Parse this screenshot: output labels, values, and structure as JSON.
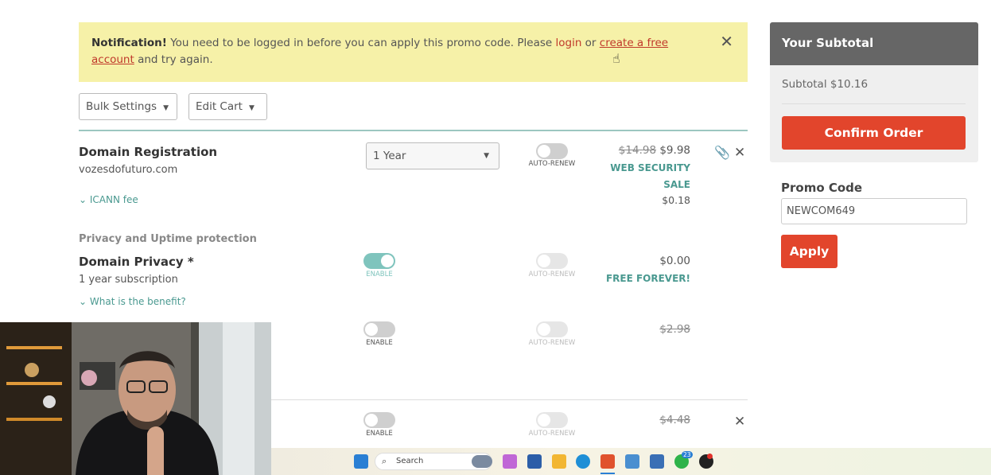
{
  "notification": {
    "bold": "Notification!",
    "text1": " You need to be logged in before you can apply this promo code. Please ",
    "login_link": "login",
    "text2": " or ",
    "create_link": "create a free account",
    "text3": " and try again."
  },
  "toolbar": {
    "bulk_settings": "Bulk Settings",
    "edit_cart": "Edit Cart"
  },
  "items": {
    "domain": {
      "title": "Domain Registration",
      "domain_name": "vozesdofuturo.com",
      "fee_toggle": "ICANN fee",
      "term": "1 Year",
      "toggle_label": "AUTO-RENEW",
      "old_price": "$14.98",
      "price": "$9.98",
      "badge_line1": "WEB SECURITY",
      "badge_line2": "SALE",
      "icann_price": "$0.18"
    },
    "section_title": "Privacy and Uptime protection",
    "privacy": {
      "title": "Domain Privacy *",
      "subtitle": "1 year subscription",
      "benefit_toggle": "What is the benefit?",
      "enable_label": "ENABLE",
      "auto_label": "AUTO-RENEW",
      "price": "$0.00",
      "badge": "FREE FOREVER!"
    },
    "item3": {
      "enable_label": "ENABLE",
      "auto_label": "AUTO-RENEW",
      "old_price": "$2.98"
    },
    "item4": {
      "enable_label": "ENABLE",
      "auto_label": "AUTO-RENEW",
      "old_price": "$4.48"
    }
  },
  "sidebar": {
    "header": "Your Subtotal",
    "subtotal": "Subtotal $10.16",
    "confirm": "Confirm Order",
    "promo_label": "Promo Code",
    "promo_value": "NEWCOM649",
    "apply": "Apply"
  },
  "taskbar": {
    "search": "Search",
    "whatsapp_badge": "23"
  },
  "colors": {
    "accent_red": "#e2452c",
    "teal": "#4a9990",
    "notification_bg": "#f6f1a8"
  }
}
